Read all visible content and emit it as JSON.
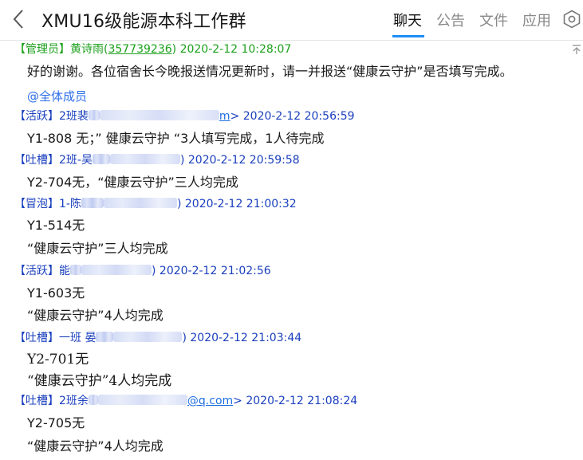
{
  "header": {
    "title": "XMU16级能源本科工作群",
    "tabs": [
      "聊天",
      "公告",
      "文件",
      "应用"
    ],
    "active_tab": "聊天",
    "icons": {
      "back": "chevron-left-icon",
      "settings": "gear-hexagon-icon",
      "pin": "pin-icon"
    },
    "accent_color": "#1e8ff5"
  },
  "messages": [
    {
      "badge": "【管理员】",
      "sender": "黄诗雨(",
      "sender_link": "357739236",
      "sender_close": ")",
      "time": "2020-2-12 10:28:07",
      "role": "admin",
      "lines": [
        "好的谢谢。各位宿舍长今晚报送情况更新时，请一并报送“健康云守护”是否填写完成。"
      ],
      "mention": "@全体成员"
    },
    {
      "badge": "【活跃】",
      "sender": "2班裴",
      "sender_link": "m",
      "sender_close": ">",
      "time": "2020-2-12 20:56:59",
      "role": "member",
      "lines": [
        "Y1-808 无；” 健康云守护 “3人填写完成，1人待完成"
      ]
    },
    {
      "badge": "【吐槽】",
      "sender": "2班-吴",
      "sender_link": "",
      "sender_close": ")",
      "time": "2020-2-12 20:59:58",
      "role": "member",
      "lines": [
        "Y2-704无，“健康云守护”三人均完成"
      ]
    },
    {
      "badge": "【冒泡】",
      "sender": "1-陈",
      "sender_link": "",
      "sender_close": ")",
      "time": "2020-2-12 21:00:32",
      "role": "member",
      "lines": [
        "Y1-514无",
        "“健康云守护”三人均完成"
      ]
    },
    {
      "badge": "【活跃】",
      "sender": "能",
      "sender_link": "",
      "sender_close": ")",
      "time": "2020-2-12 21:02:56",
      "role": "member",
      "lines": [
        "Y1-603无",
        "“健康云守护”4人均完成"
      ]
    },
    {
      "badge": "【吐槽】",
      "sender": "一班 晏",
      "sender_link": "",
      "sender_close": ")",
      "time": "2020-2-12 21:03:44",
      "role": "member",
      "lines": [
        "Y2-701无",
        "“健康云守护”4人均完成"
      ]
    },
    {
      "badge": "【吐槽】",
      "sender": "2班余",
      "sender_link": "@q.com",
      "sender_close": ">",
      "time": "2020-2-12 21:08:24",
      "role": "member",
      "lines": [
        "Y2-705无",
        "“健康云守护”4人均完成"
      ]
    }
  ]
}
